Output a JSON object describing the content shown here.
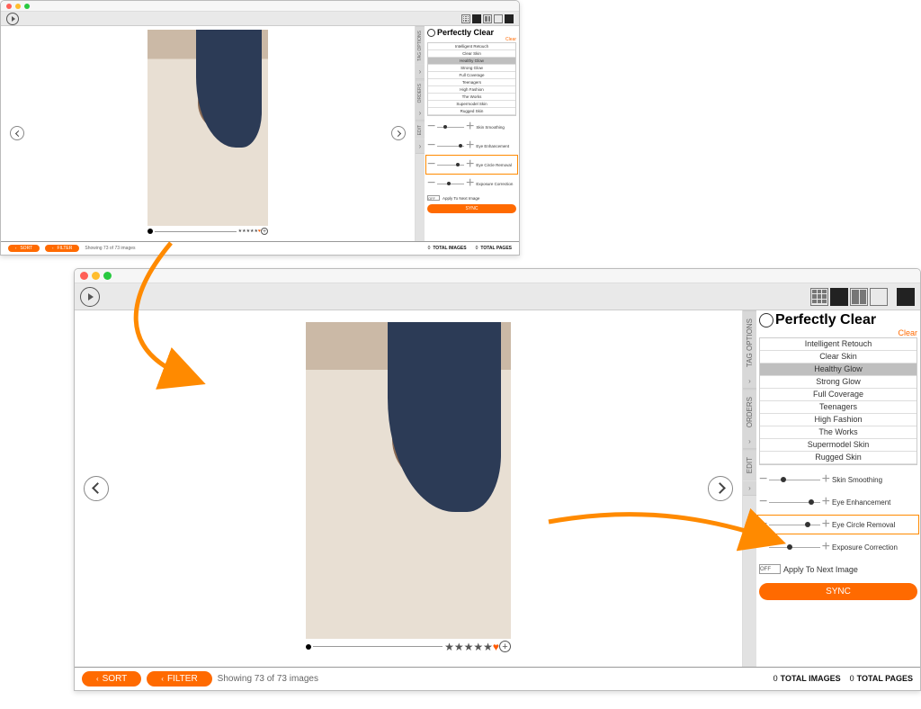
{
  "brand": {
    "name": "Perfectly Clear",
    "clear_link": "Clear"
  },
  "tabs": {
    "tag_options": "TAG OPTIONS",
    "orders": "ORDERS",
    "edit": "EDIT"
  },
  "presets": [
    "Intelligent Retouch",
    "Clear Skin",
    "Healthy Glow",
    "Strong Glow",
    "Full Coverage",
    "Teenagers",
    "High Fashion",
    "The Works",
    "Supermodel Skin",
    "Rugged Skin"
  ],
  "preset_selected_index": 2,
  "sliders": [
    {
      "label": "Skin Smoothing",
      "thumb": 22
    },
    {
      "label": "Eye Enhancement",
      "thumb": 78
    },
    {
      "label": "Eye Circle Removal",
      "thumb": 70,
      "highlight": true
    },
    {
      "label": "Exposure Correction",
      "thumb": 35
    }
  ],
  "apply_next": {
    "toggle_label": "OFF",
    "label": "Apply To Next Image"
  },
  "sync_label": "SYNC",
  "footer": {
    "sort": "SORT",
    "filter": "FILTER",
    "showing": "Showing 73 of 73 images",
    "total_images_n": "0",
    "total_images": "TOTAL IMAGES",
    "total_pages_n": "0",
    "total_pages": "TOTAL PAGES"
  },
  "rating_stars": "★★★★★",
  "plus": "+"
}
